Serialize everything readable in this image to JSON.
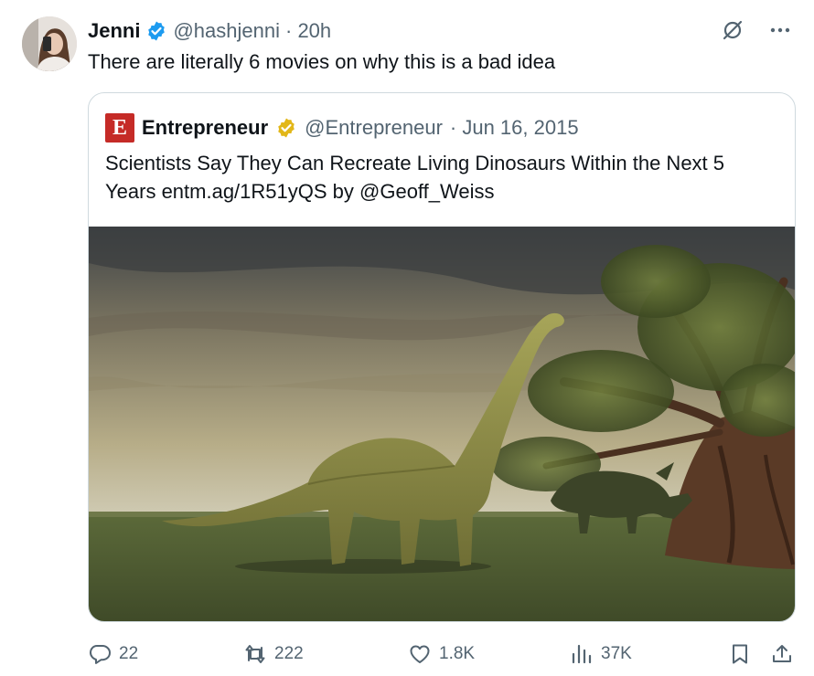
{
  "tweet": {
    "author": {
      "display_name": "Jenni",
      "handle": "@hashjenni",
      "time": "· 20h",
      "verified": true
    },
    "text": "There are literally 6 movies on why this is a bad idea",
    "quote": {
      "logo_letter": "E",
      "author": {
        "display_name": "Entrepreneur",
        "handle": "@Entrepreneur",
        "time": "· Jun 16, 2015",
        "verified_gold": true
      },
      "text": "Scientists Say They Can Recreate Living Dinosaurs Within the Next 5 Years entm.ag/1R51yQS by @Geoff_Weiss"
    },
    "actions": {
      "reply_count": "22",
      "repost_count": "222",
      "like_count": "1.8K",
      "view_count": "37K"
    }
  },
  "icons": {
    "header": [
      "grok-icon",
      "more-icon"
    ],
    "actions": [
      "reply-icon",
      "repost-icon",
      "like-icon",
      "views-icon",
      "bookmark-icon",
      "share-icon"
    ]
  },
  "colors": {
    "verified_blue": "#1d9bf0",
    "verified_gold": "#e2b719",
    "muted_text": "#536471",
    "logo_red": "#c52b27",
    "border": "#cfd9de"
  }
}
